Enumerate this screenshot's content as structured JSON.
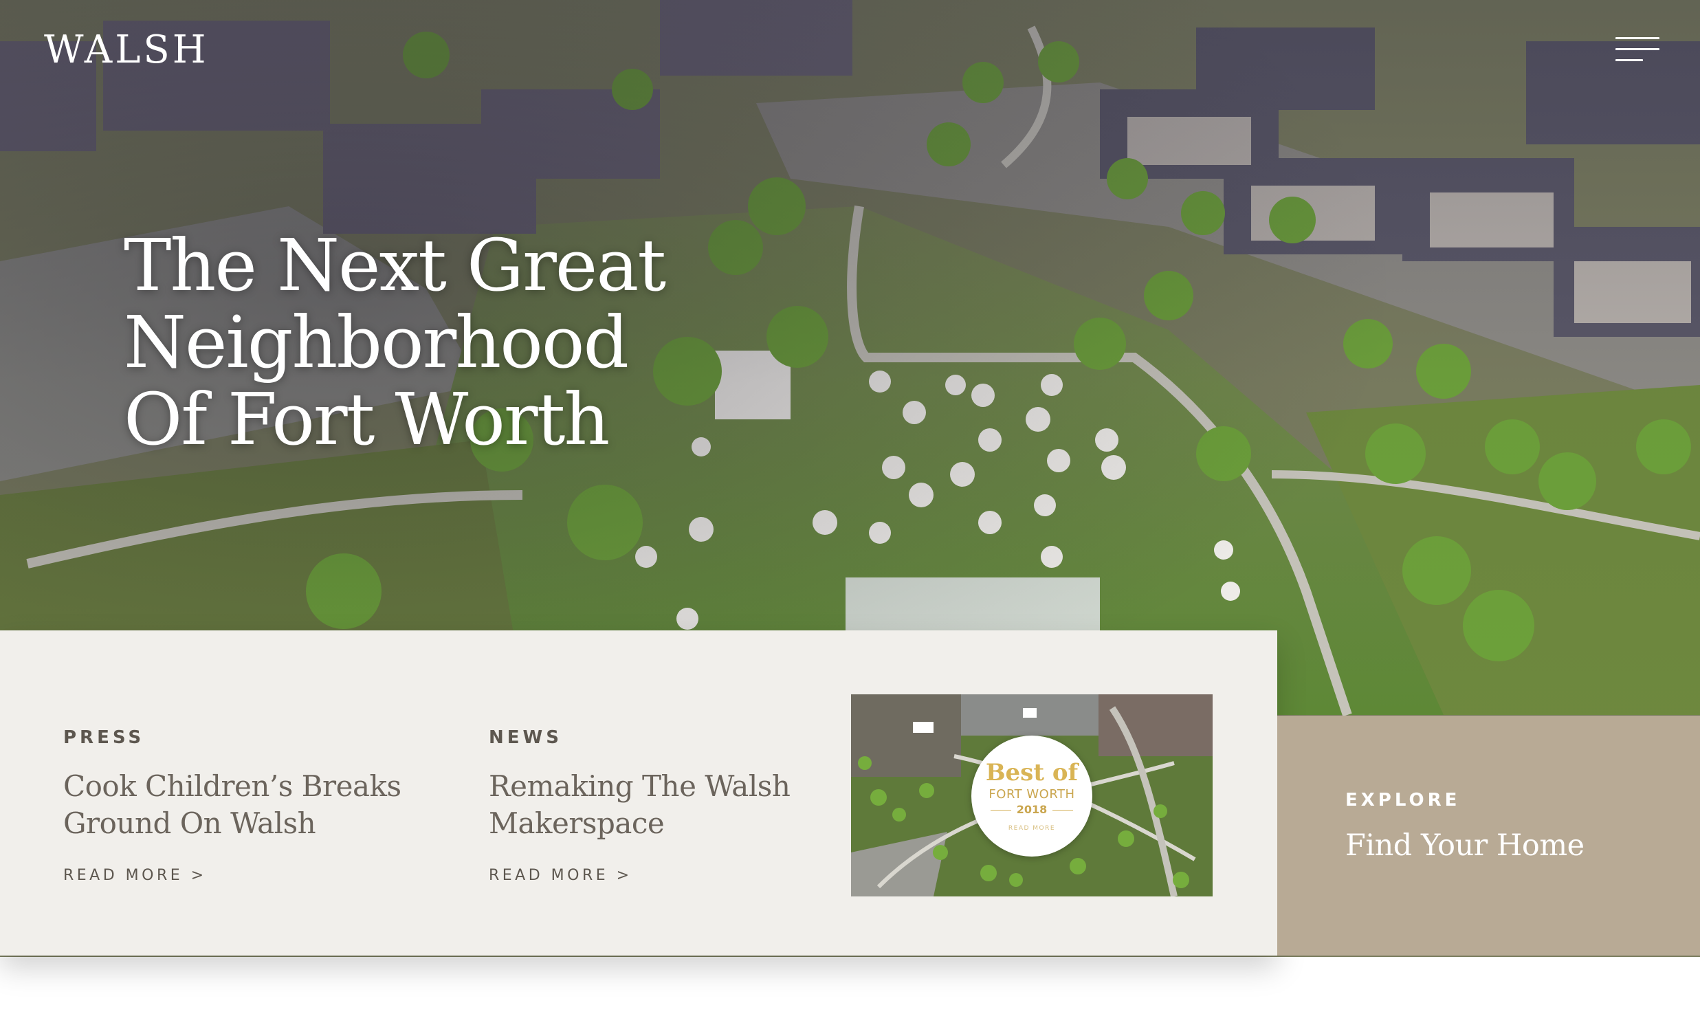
{
  "header": {
    "logo": "WALSH",
    "menu_icon": "hamburger-menu-icon"
  },
  "hero": {
    "title_lines": [
      "The Next Great",
      "Neighborhood",
      "Of Fort Worth"
    ]
  },
  "news": {
    "items": [
      {
        "kicker": "PRESS",
        "headline": "Cook Children’s Breaks Ground On Walsh",
        "link": "READ MORE >"
      },
      {
        "kicker": "NEWS",
        "headline": "Remaking The Walsh Makerspace",
        "link": "READ MORE >"
      }
    ],
    "image_badge": {
      "line1": "Best of",
      "line2": "FORT WORTH",
      "line3": "2018",
      "line4": "READ MORE"
    }
  },
  "explore": {
    "kicker": "EXPLORE",
    "cta": "Find Your Home"
  },
  "colors": {
    "card_bg": "#f1efeb",
    "explore_bg": "#b8aa95",
    "text_muted": "#6b645c",
    "badge_gold": "#d9b455"
  }
}
